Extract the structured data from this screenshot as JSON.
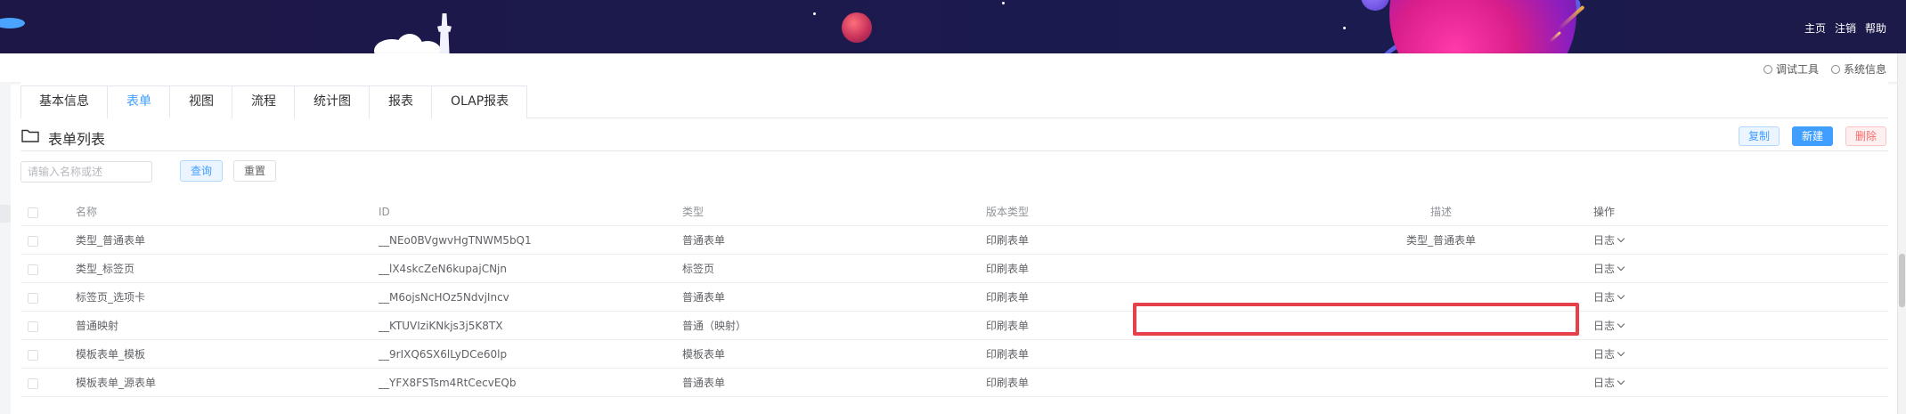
{
  "header": {
    "nav_links": [
      "主页",
      "注销",
      "帮助"
    ]
  },
  "subbar": {
    "debug_tool": "调试工具",
    "system_info": "系统信息"
  },
  "tabs": [
    {
      "label": "基本信息",
      "active": false
    },
    {
      "label": "表单",
      "active": true
    },
    {
      "label": "视图",
      "active": false
    },
    {
      "label": "流程",
      "active": false
    },
    {
      "label": "统计图",
      "active": false
    },
    {
      "label": "报表",
      "active": false
    },
    {
      "label": "OLAP报表",
      "active": false
    }
  ],
  "section": {
    "title": "表单列表",
    "buttons": {
      "copy": "复制",
      "new": "新建",
      "delete": "删除"
    }
  },
  "search": {
    "placeholder": "请输入名称或述",
    "query": "查询",
    "reset": "重置"
  },
  "table": {
    "columns": [
      "名称",
      "ID",
      "类型",
      "版本类型",
      "描述",
      "操作"
    ],
    "rows": [
      {
        "name": "类型_普通表单",
        "id": "__NEo0BVgwvHgTNWM5bQ1",
        "type": "普通表单",
        "version": "印刷表单",
        "desc": "类型_普通表单",
        "op": "日志"
      },
      {
        "name": "类型_标签页",
        "id": "__lX4skcZeN6kupajCNjn",
        "type": "标签页",
        "version": "印刷表单",
        "desc": "",
        "op": "日志"
      },
      {
        "name": "标签页_选项卡",
        "id": "__M6ojsNcHOz5NdvjIncv",
        "type": "普通表单",
        "version": "印刷表单",
        "desc": "",
        "op": "日志"
      },
      {
        "name": "普通映射",
        "id": "__KTUVIziKNkjs3j5K8TX",
        "type": "普通（映射）",
        "version": "印刷表单",
        "desc": "",
        "op": "日志"
      },
      {
        "name": "模板表单_模板",
        "id": "__9rIXQ6SX6lLyDCe60lp",
        "type": "模板表单",
        "version": "印刷表单",
        "desc": "",
        "op": "日志"
      },
      {
        "name": "模板表单_源表单",
        "id": "__YFX8FSTsm4RtCecvEQb",
        "type": "普通表单",
        "version": "印刷表单",
        "desc": "",
        "op": "日志"
      }
    ]
  }
}
